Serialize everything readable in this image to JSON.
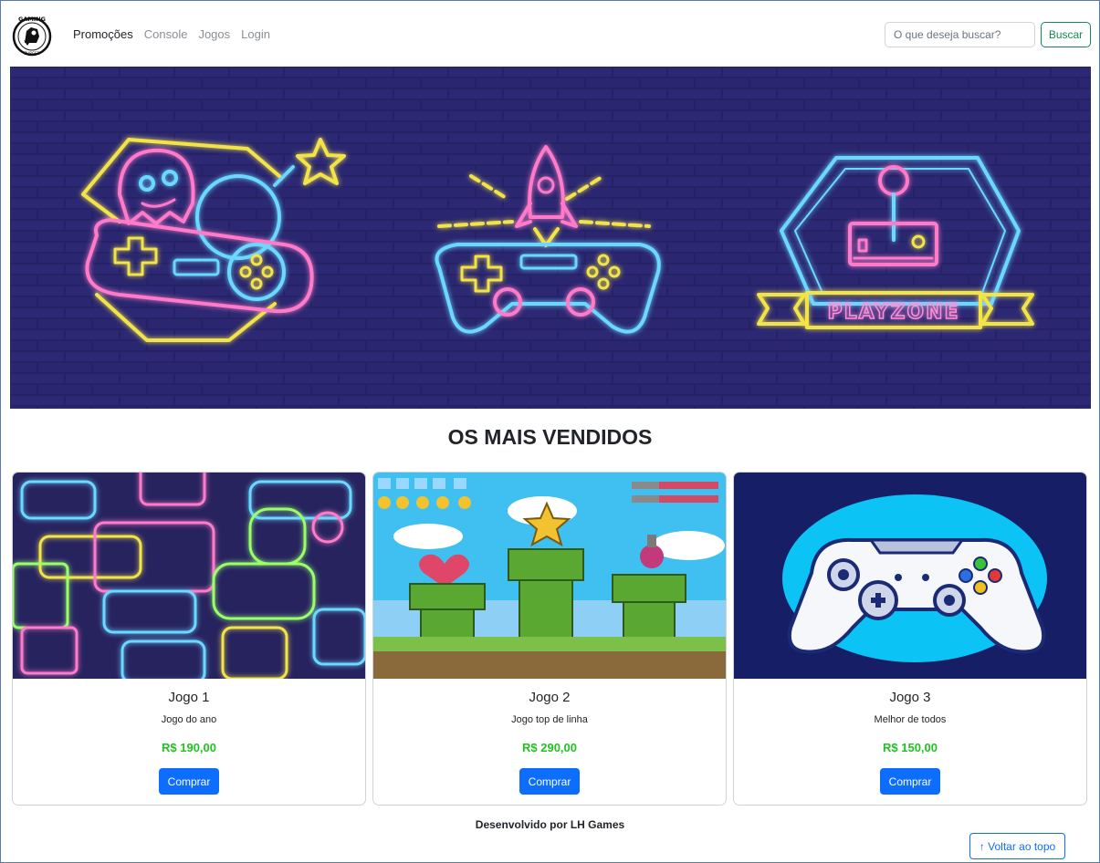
{
  "brand": {
    "logo_text": "GAMING",
    "logo_subtext": "BURGER"
  },
  "nav": {
    "items": [
      {
        "label": "Promoções"
      },
      {
        "label": "Console"
      },
      {
        "label": "Jogos"
      },
      {
        "label": "Login"
      }
    ]
  },
  "search": {
    "placeholder": "O que deseja buscar?",
    "button_label": "Buscar",
    "button_color": "#198754"
  },
  "hero": {
    "banner_text": "PLAYZONE",
    "background_color": "#1f1c55"
  },
  "section": {
    "title": "OS MAIS VENDIDOS"
  },
  "products": [
    {
      "title": "Jogo 1",
      "description": "Jogo do ano",
      "price": "R$ 190,00",
      "button_label": "Comprar"
    },
    {
      "title": "Jogo 2",
      "description": "Jogo top de linha",
      "price": "R$ 290,00",
      "button_label": "Comprar"
    },
    {
      "title": "Jogo 3",
      "description": "Melhor de todos",
      "price": "R$ 150,00",
      "button_label": "Comprar"
    }
  ],
  "colors": {
    "primary": "#0d6efd",
    "price": "#22c222"
  },
  "footer": {
    "credit": "Desenvolvido por LH Games",
    "back_to_top": "↑ Voltar ao topo"
  }
}
